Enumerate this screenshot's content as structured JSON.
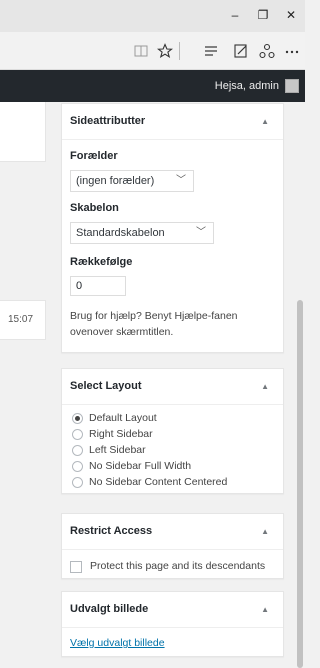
{
  "window": {
    "minimize_glyph": "–",
    "restore_glyph": "❐",
    "close_glyph": "✕"
  },
  "browser": {
    "icons": [
      "reading-view-icon",
      "favorite-star-icon",
      "hub-icon",
      "web-note-icon",
      "share-icon",
      "more-icon"
    ]
  },
  "adminbar": {
    "greeting": "Hejsa, admin"
  },
  "left": {
    "time": "15:07"
  },
  "page_attributes": {
    "title": "Sideattributter",
    "parent_label": "Forælder",
    "parent_value": "(ingen forælder)",
    "template_label": "Skabelon",
    "template_value": "Standardskabelon",
    "order_label": "Rækkefølge",
    "order_value": "0",
    "help_text": "Brug for hjælp? Benyt Hjælpe-fanen ovenover skærmtitlen."
  },
  "select_layout": {
    "title": "Select Layout",
    "options": [
      {
        "label": "Default Layout",
        "checked": true
      },
      {
        "label": "Right Sidebar",
        "checked": false
      },
      {
        "label": "Left Sidebar",
        "checked": false
      },
      {
        "label": "No Sidebar Full Width",
        "checked": false
      },
      {
        "label": "No Sidebar Content Centered",
        "checked": false
      }
    ]
  },
  "restrict_access": {
    "title": "Restrict Access",
    "checkbox_label": "Protect this page and its descendants"
  },
  "featured_image": {
    "title": "Udvalgt billede",
    "link": "Vælg udvalgt billede"
  }
}
